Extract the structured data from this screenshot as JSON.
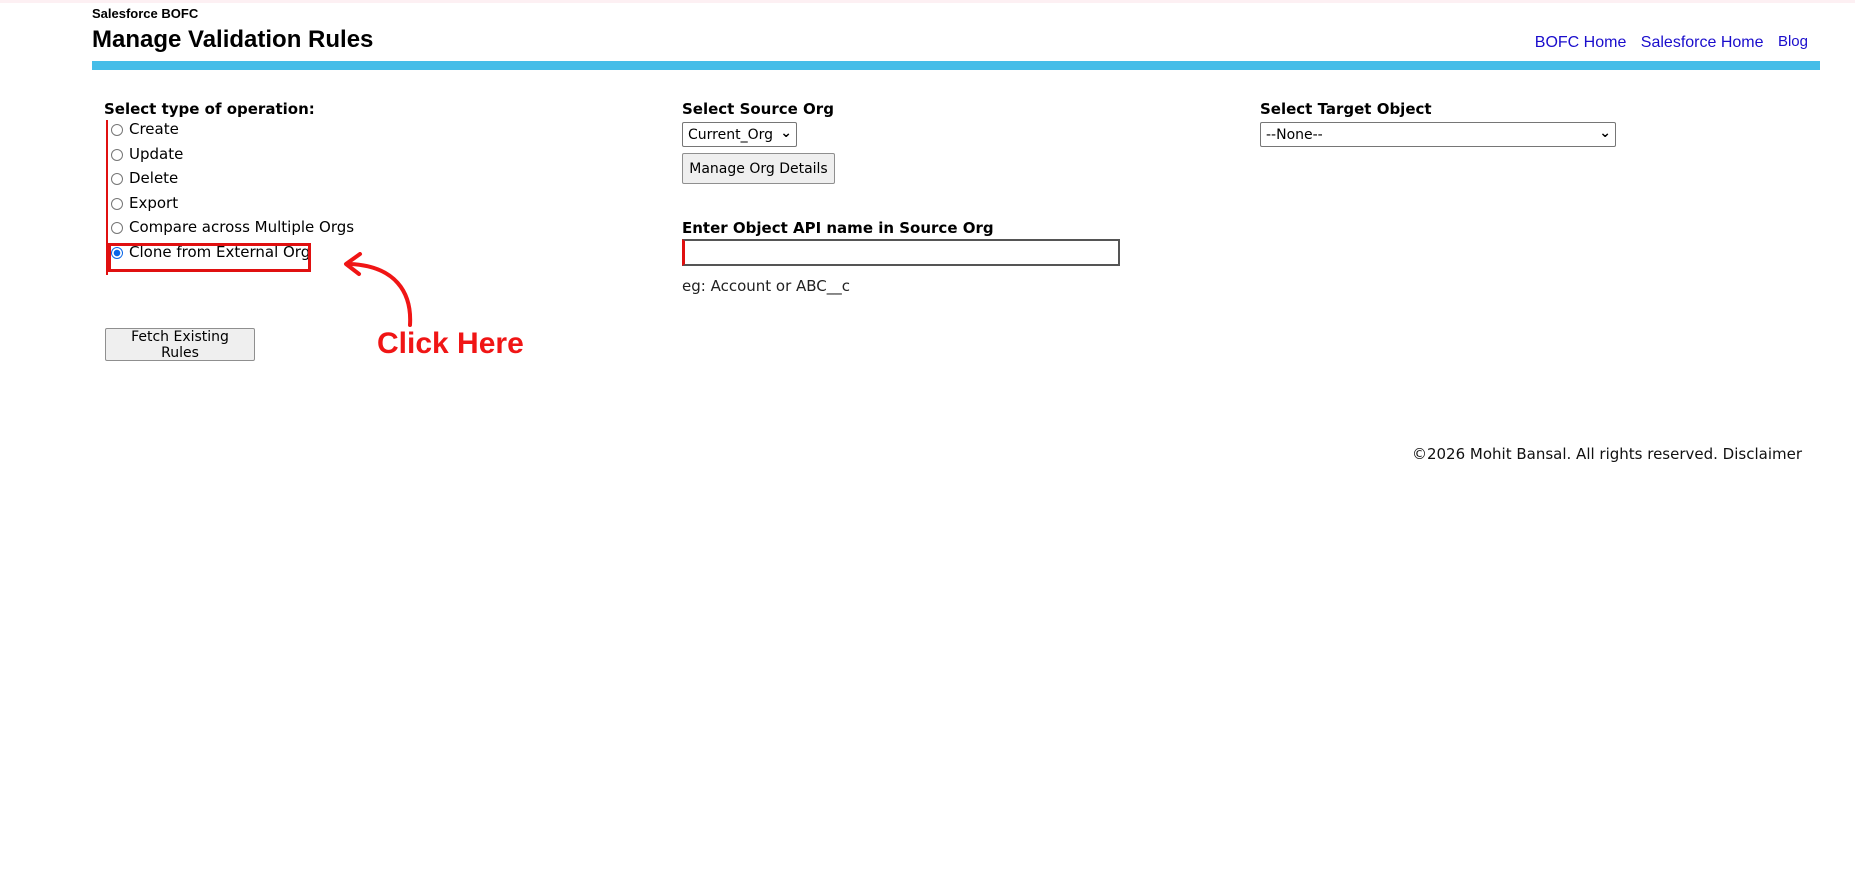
{
  "app": {
    "name": "Salesforce BOFC",
    "title": "Manage Validation Rules"
  },
  "nav": {
    "links": [
      "BOFC Home",
      "Salesforce Home",
      "Blog"
    ]
  },
  "operation": {
    "label": "Select type of operation:",
    "options": [
      "Create",
      "Update",
      "Delete",
      "Export",
      "Compare across Multiple Orgs",
      "Clone from External Org"
    ],
    "selected": "Clone from External Org",
    "fetch_button": "Fetch Existing Rules"
  },
  "source_org": {
    "label": "Select Source Org",
    "selected": "Current_Org",
    "manage_button": "Manage Org Details"
  },
  "object_api": {
    "label": "Enter Object API name in Source Org",
    "value": "",
    "hint": "eg: Account or ABC__c"
  },
  "target_object": {
    "label": "Select Target Object",
    "selected": "--None--"
  },
  "annotation": {
    "text": "Click Here",
    "color": "#f01515"
  },
  "footer": {
    "text": "©2026 Mohit Bansal. All rights reserved. Disclaimer"
  },
  "colors": {
    "header_bar": "#45bde8",
    "link": "#1a0dcc",
    "highlight": "#e01010"
  }
}
